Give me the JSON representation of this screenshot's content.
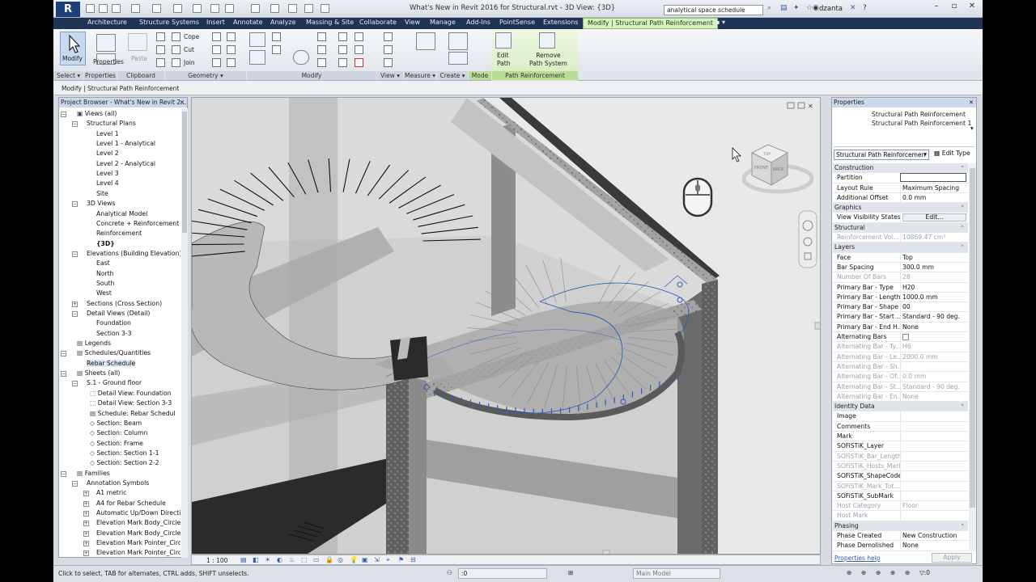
{
  "title_bar": {
    "window_title": "What's New in Revit 2016 for Structural.rvt - 3D View: {3D}",
    "search_value": "analytical space schedule",
    "user": "dzanta",
    "logo": "R"
  },
  "ribbon_tabs": [
    "Architecture",
    "Structure",
    "Systems",
    "Insert",
    "Annotate",
    "Analyze",
    "Massing & Site",
    "Collaborate",
    "View",
    "Manage",
    "Add-Ins",
    "PointSense",
    "Extensions",
    "Modify | Structural Path Reinforcement"
  ],
  "ribbon": {
    "modify_label": "Modify",
    "properties_label": "Properties",
    "paste_label": "Paste",
    "cope_label": "Cope",
    "cut_label": "Cut",
    "join_label": "Join",
    "edit_path_label": "Edit\nPath",
    "remove_path_label": "Remove\nPath System",
    "panels": [
      "Select",
      "Properties",
      "Clipboard",
      "Geometry",
      "Modify",
      "View",
      "Measure",
      "Create",
      "Mode",
      "Path Reinforcement"
    ]
  },
  "options_bar": {
    "context": "Modify | Structural Path Reinforcement"
  },
  "project_browser": {
    "title": "Project Browser - What's New in Revit 2...",
    "tree": [
      {
        "label": "Views (all)",
        "level": 0,
        "exp": "-",
        "icon": "views"
      },
      {
        "label": "Structural Plans",
        "level": 1,
        "exp": "-"
      },
      {
        "label": "Level 1",
        "level": 2
      },
      {
        "label": "Level 1 - Analytical",
        "level": 2
      },
      {
        "label": "Level 2",
        "level": 2
      },
      {
        "label": "Level 2 - Analytical",
        "level": 2
      },
      {
        "label": "Level 3",
        "level": 2
      },
      {
        "label": "Level 4",
        "level": 2
      },
      {
        "label": "Site",
        "level": 2
      },
      {
        "label": "3D Views",
        "level": 1,
        "exp": "-"
      },
      {
        "label": "Analytical Model",
        "level": 2
      },
      {
        "label": "Concrete + Reinforcement",
        "level": 2
      },
      {
        "label": "Reinforcement",
        "level": 2
      },
      {
        "label": "{3D}",
        "level": 2,
        "bold": true
      },
      {
        "label": "Elevations (Building Elevation)",
        "level": 1,
        "exp": "-"
      },
      {
        "label": "East",
        "level": 2
      },
      {
        "label": "North",
        "level": 2
      },
      {
        "label": "South",
        "level": 2
      },
      {
        "label": "West",
        "level": 2
      },
      {
        "label": "Sections (Cross Section)",
        "level": 1,
        "exp": "+"
      },
      {
        "label": "Detail Views (Detail)",
        "level": 1,
        "exp": "-"
      },
      {
        "label": "Foundation",
        "level": 2
      },
      {
        "label": "Section 3-3",
        "level": 2
      },
      {
        "label": "Legends",
        "level": 0,
        "icon": "table"
      },
      {
        "label": "Schedules/Quantities",
        "level": 0,
        "exp": "-",
        "icon": "table"
      },
      {
        "label": "Rebar Schedule",
        "level": 1,
        "selected": true
      },
      {
        "label": "Sheets (all)",
        "level": 0,
        "exp": "-",
        "icon": "table"
      },
      {
        "label": "S.1 - Ground floor",
        "level": 1,
        "exp": "-"
      },
      {
        "label": "Detail View: Foundation",
        "level": 2,
        "icon": "view"
      },
      {
        "label": "Detail View: Section 3-3",
        "level": 2,
        "icon": "view"
      },
      {
        "label": "Schedule: Rebar Schedul",
        "level": 2,
        "icon": "table"
      },
      {
        "label": "Section: Beam",
        "level": 2,
        "icon": "sec"
      },
      {
        "label": "Section: Column",
        "level": 2,
        "icon": "sec"
      },
      {
        "label": "Section: Frame",
        "level": 2,
        "icon": "sec"
      },
      {
        "label": "Section: Section 1-1",
        "level": 2,
        "icon": "sec"
      },
      {
        "label": "Section: Section 2-2",
        "level": 2,
        "icon": "sec"
      },
      {
        "label": "Families",
        "level": 0,
        "exp": "-",
        "icon": "table"
      },
      {
        "label": "Annotation Symbols",
        "level": 1,
        "exp": "-"
      },
      {
        "label": "A1 metric",
        "level": 2,
        "exp": "+"
      },
      {
        "label": "A4 for Rebar Schedule",
        "level": 2,
        "exp": "+"
      },
      {
        "label": "Automatic Up/Down Directic",
        "level": 2,
        "exp": "+"
      },
      {
        "label": "Elevation Mark Body_Circle-1",
        "level": 2,
        "exp": "+"
      },
      {
        "label": "Elevation Mark Body_Circle-3",
        "level": 2,
        "exp": "+"
      },
      {
        "label": "Elevation Mark Pointer_Circle",
        "level": 2,
        "exp": "+"
      },
      {
        "label": "Elevation Mark Pointer_Circle",
        "level": 2,
        "exp": "+"
      }
    ]
  },
  "viewport": {
    "scale": "1 : 100"
  },
  "viewcube": {
    "face_left": "FRONT",
    "face_right": "BACK",
    "face_top": "TOP"
  },
  "properties": {
    "title": "Properties",
    "type_name_1": "Structural Path Reinforcement",
    "type_name_2": "Structural Path Reinforcement 1",
    "type_dropdown": "Structural Path Reinforcemen",
    "edit_type": "Edit Type",
    "rows": [
      {
        "k": "Construction",
        "grp": true
      },
      {
        "k": "Partition",
        "v": ""
      },
      {
        "k": "Layout Rule",
        "v": "Maximum Spacing"
      },
      {
        "k": "Additional Offset",
        "v": "0.0 mm"
      },
      {
        "k": "Graphics",
        "grp": true
      },
      {
        "k": "View Visibility States",
        "v": "Edit...",
        "btn": true
      },
      {
        "k": "Structural",
        "grp": true
      },
      {
        "k": "Reinforcement Vol...",
        "v": "10869.47 cm³",
        "dis": true
      },
      {
        "k": "Layers",
        "grp": true
      },
      {
        "k": "Face",
        "v": "Top"
      },
      {
        "k": "Bar Spacing",
        "v": "300.0 mm"
      },
      {
        "k": "Number Of Bars",
        "v": "28",
        "dis": true
      },
      {
        "k": "Primary Bar - Type",
        "v": "H20"
      },
      {
        "k": "Primary Bar - Length",
        "v": "1000.0 mm"
      },
      {
        "k": "Primary Bar - Shape",
        "v": "00"
      },
      {
        "k": "Primary Bar - Start ...",
        "v": "Standard - 90 deg."
      },
      {
        "k": "Primary Bar - End H...",
        "v": "None"
      },
      {
        "k": "Alternating Bars",
        "v": "",
        "chk": true
      },
      {
        "k": "Alternating Bar - Ty...",
        "v": "H6",
        "dis": true
      },
      {
        "k": "Alternating Bar - Le...",
        "v": "2000.0 mm",
        "dis": true
      },
      {
        "k": "Alternating Bar - Sh...",
        "v": "",
        "dis": true
      },
      {
        "k": "Alternating Bar - Of...",
        "v": "0.0 mm",
        "dis": true
      },
      {
        "k": "Alternating Bar - St...",
        "v": "Standard - 90 deg.",
        "dis": true
      },
      {
        "k": "Alternating Bar - En...",
        "v": "None",
        "dis": true
      },
      {
        "k": "Identity Data",
        "grp": true
      },
      {
        "k": "Image",
        "v": ""
      },
      {
        "k": "Comments",
        "v": ""
      },
      {
        "k": "Mark",
        "v": ""
      },
      {
        "k": "SOFiSTiK_Layer",
        "v": ""
      },
      {
        "k": "SOFiSTiK_Bar_Length",
        "v": "",
        "dis": true
      },
      {
        "k": "SOFiSTiK_Hosts_Mark",
        "v": "",
        "dis": true
      },
      {
        "k": "SOFiSTiK_ShapeCode",
        "v": ""
      },
      {
        "k": "SOFiSTiK_Mark_Tot...",
        "v": "",
        "dis": true
      },
      {
        "k": "SOFiSTiK_SubMark",
        "v": ""
      },
      {
        "k": "Host Category",
        "v": "Floor",
        "dis": true
      },
      {
        "k": "Host Mark",
        "v": "",
        "dis": true
      },
      {
        "k": "Phasing",
        "grp": true
      },
      {
        "k": "Phase Created",
        "v": "New Construction"
      },
      {
        "k": "Phase Demolished",
        "v": "None"
      }
    ],
    "help_link": "Properties help",
    "apply": "Apply"
  },
  "status_bar": {
    "hint": "Click to select, TAB for alternates, CTRL adds, SHIFT unselects.",
    "scale_value": ":0",
    "model": "Main Model"
  },
  "colors": {
    "tab_bar": "#1f3354",
    "context_tab": "#d9f0c3",
    "selection_blue": "#2f5fb8",
    "concrete": "#9a9a9a"
  }
}
